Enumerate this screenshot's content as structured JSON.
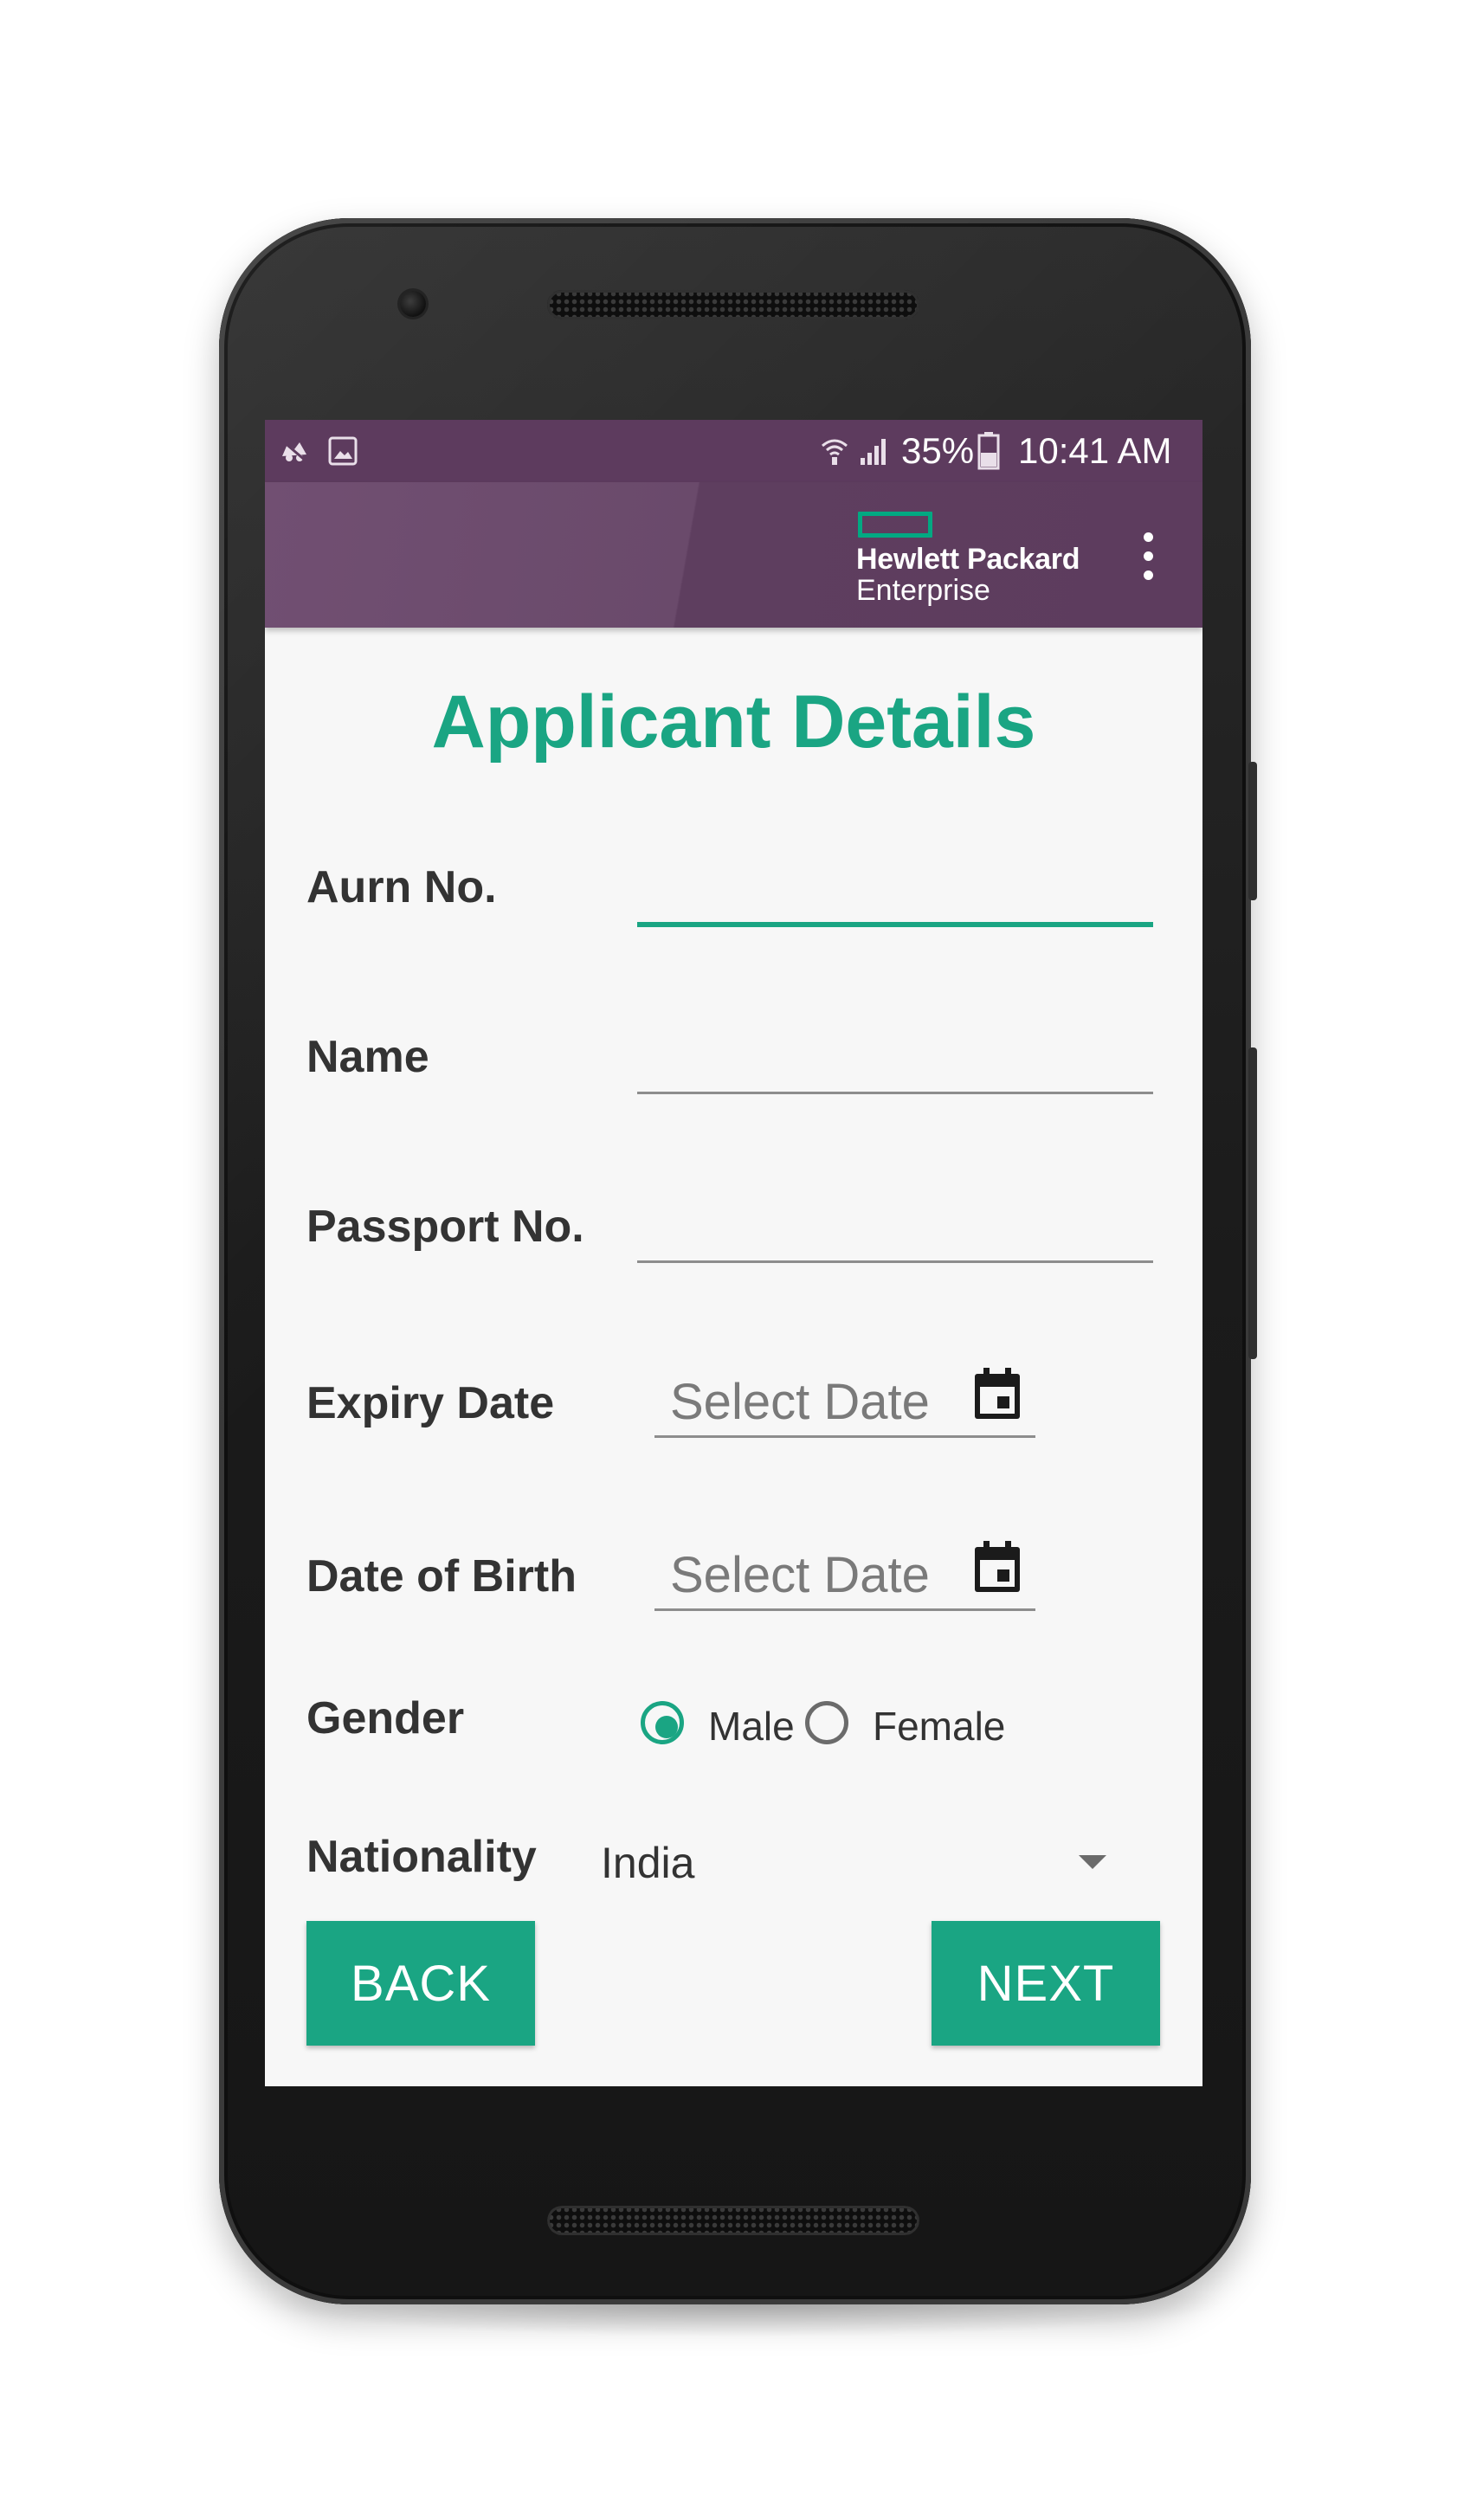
{
  "status_bar": {
    "battery": "35%",
    "time": "10:41 AM",
    "left_icons": [
      "notification-icon",
      "gallery-icon"
    ],
    "right_icons": [
      "wifi-icon",
      "signal-icon",
      "battery-icon"
    ]
  },
  "app_bar": {
    "logo_line1": "Hewlett Packard",
    "logo_line2": "Enterprise",
    "menu_icon": "overflow-menu-icon"
  },
  "page": {
    "title": "Applicant Details"
  },
  "form": {
    "aurn_label": "Aurn No.",
    "aurn_value": "",
    "name_label": "Name",
    "name_value": "",
    "passport_label": "Passport No.",
    "passport_value": "",
    "expiry_label": "Expiry Date",
    "expiry_placeholder": "Select Date",
    "dob_label": "Date of Birth",
    "dob_placeholder": "Select Date",
    "gender_label": "Gender",
    "gender_options": [
      "Male",
      "Female"
    ],
    "gender_selected": "Male",
    "nationality_label": "Nationality",
    "nationality_value": "India"
  },
  "buttons": {
    "back": "BACK",
    "next": "NEXT"
  },
  "colors": {
    "accent": "#1aa583",
    "app_bar": "#5d3c5e",
    "status_bar": "#5d3b5e",
    "hpe_green": "#01a982",
    "background": "#f7f7f7"
  }
}
